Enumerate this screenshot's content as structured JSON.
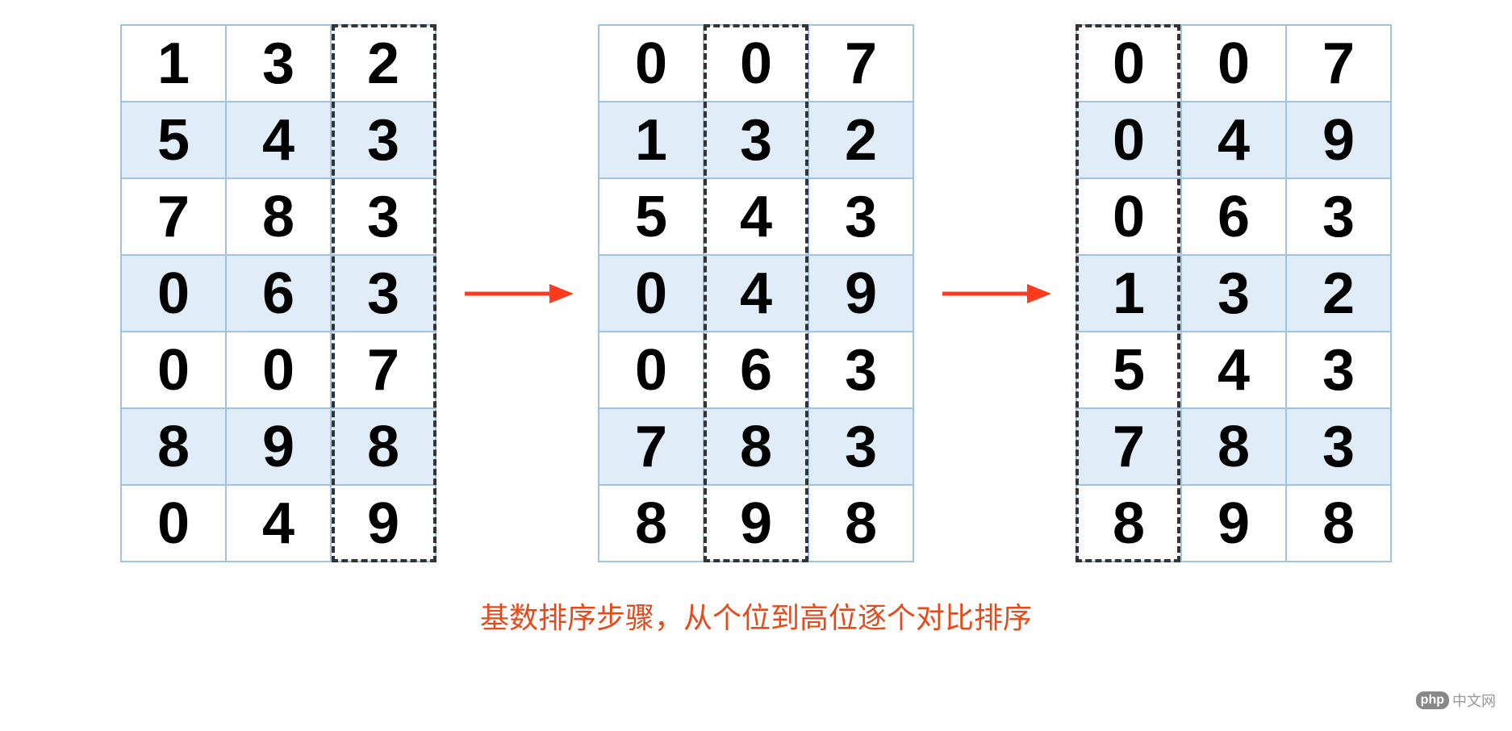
{
  "tables": [
    {
      "highlight_col": 2,
      "rows": [
        [
          "1",
          "3",
          "2"
        ],
        [
          "5",
          "4",
          "3"
        ],
        [
          "7",
          "8",
          "3"
        ],
        [
          "0",
          "6",
          "3"
        ],
        [
          "0",
          "0",
          "7"
        ],
        [
          "8",
          "9",
          "8"
        ],
        [
          "0",
          "4",
          "9"
        ]
      ]
    },
    {
      "highlight_col": 1,
      "rows": [
        [
          "0",
          "0",
          "7"
        ],
        [
          "1",
          "3",
          "2"
        ],
        [
          "5",
          "4",
          "3"
        ],
        [
          "0",
          "4",
          "9"
        ],
        [
          "0",
          "6",
          "3"
        ],
        [
          "7",
          "8",
          "3"
        ],
        [
          "8",
          "9",
          "8"
        ]
      ]
    },
    {
      "highlight_col": 0,
      "rows": [
        [
          "0",
          "0",
          "7"
        ],
        [
          "0",
          "4",
          "9"
        ],
        [
          "0",
          "6",
          "3"
        ],
        [
          "1",
          "3",
          "2"
        ],
        [
          "5",
          "4",
          "3"
        ],
        [
          "7",
          "8",
          "3"
        ],
        [
          "8",
          "9",
          "8"
        ]
      ]
    }
  ],
  "caption": "基数排序步骤，从个位到高位逐个对比排序",
  "watermark": "中文网",
  "watermark_logo": "php",
  "colors": {
    "border": "#9dc3e6",
    "row_alt": "#e0ecf7",
    "arrow": "#ff3b1f",
    "caption": "#e64a19"
  }
}
